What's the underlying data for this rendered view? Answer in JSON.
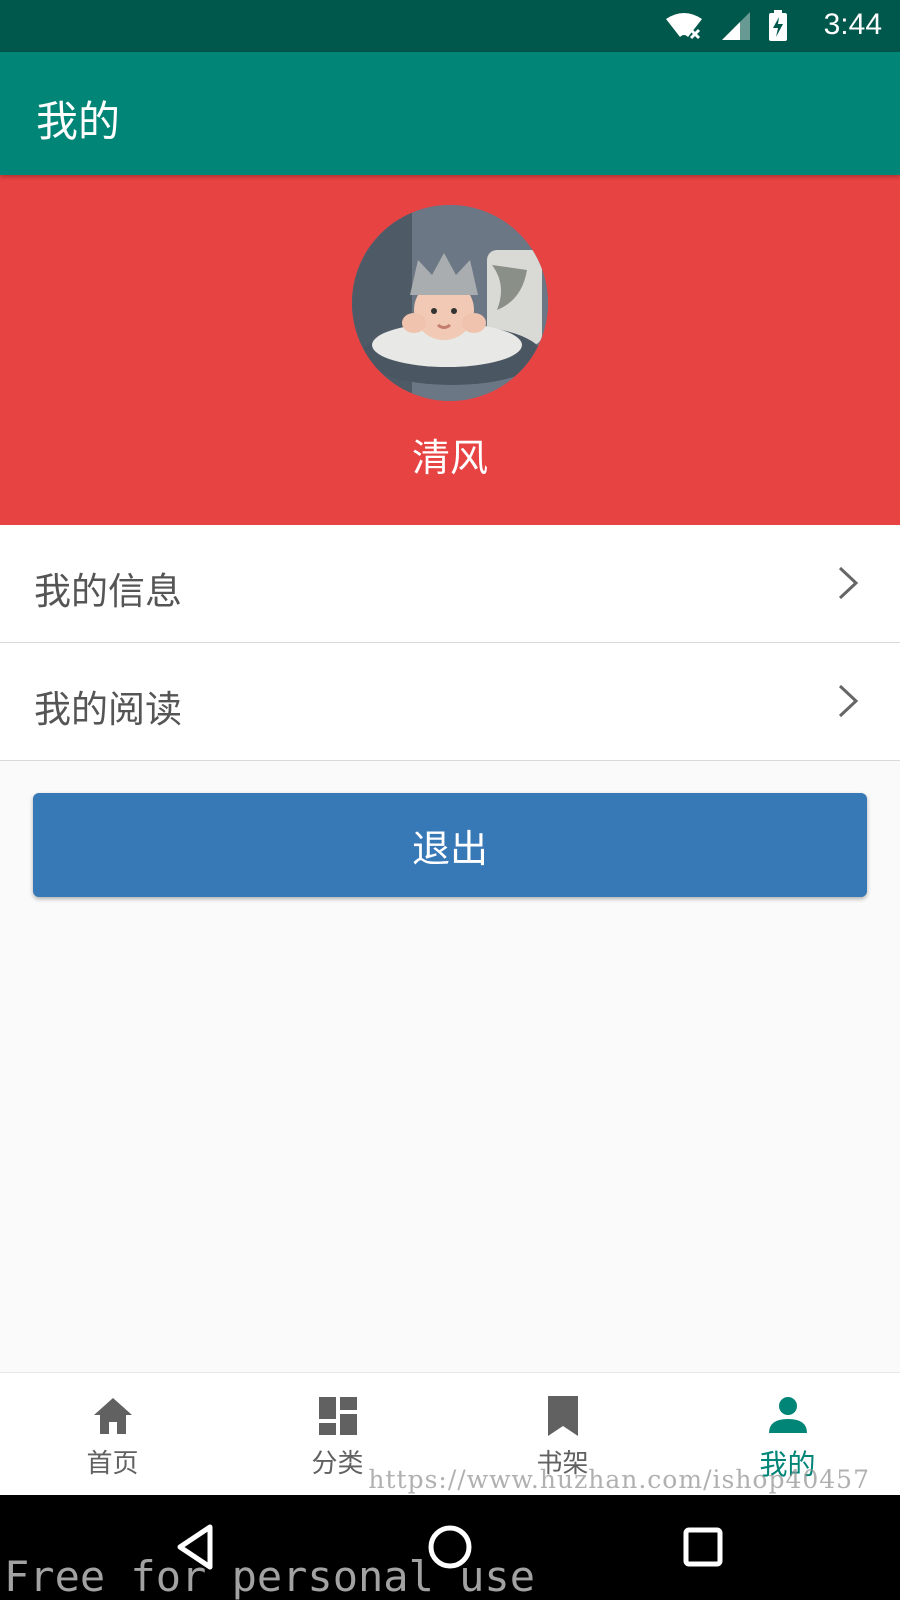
{
  "status_bar": {
    "time": "3:44",
    "icons": [
      "wifi-no-internet-icon",
      "cell-signal-icon",
      "battery-charging-icon"
    ]
  },
  "app_bar": {
    "title": "我的",
    "color": "#008577"
  },
  "profile": {
    "background_color": "#e84343",
    "username": "清风",
    "avatar": "baby-photo-avatar"
  },
  "menu": {
    "items": [
      {
        "label": "我的信息",
        "icon": "chevron-right-icon"
      },
      {
        "label": "我的阅读",
        "icon": "chevron-right-icon"
      }
    ]
  },
  "logout": {
    "label": "退出",
    "color": "#3778b6"
  },
  "bottom_nav": {
    "active_color": "#008577",
    "items": [
      {
        "label": "首页",
        "icon": "home-icon",
        "active": false
      },
      {
        "label": "分类",
        "icon": "dashboard-icon",
        "active": false
      },
      {
        "label": "书架",
        "icon": "bookmark-icon",
        "active": false
      },
      {
        "label": "我的",
        "icon": "person-icon",
        "active": true
      }
    ]
  },
  "system_nav": {
    "buttons": [
      "back-icon",
      "home-circle-icon",
      "recents-icon"
    ]
  },
  "watermarks": {
    "url": "https://www.huzhan.com/ishop40457",
    "free": "Free for personal use"
  }
}
